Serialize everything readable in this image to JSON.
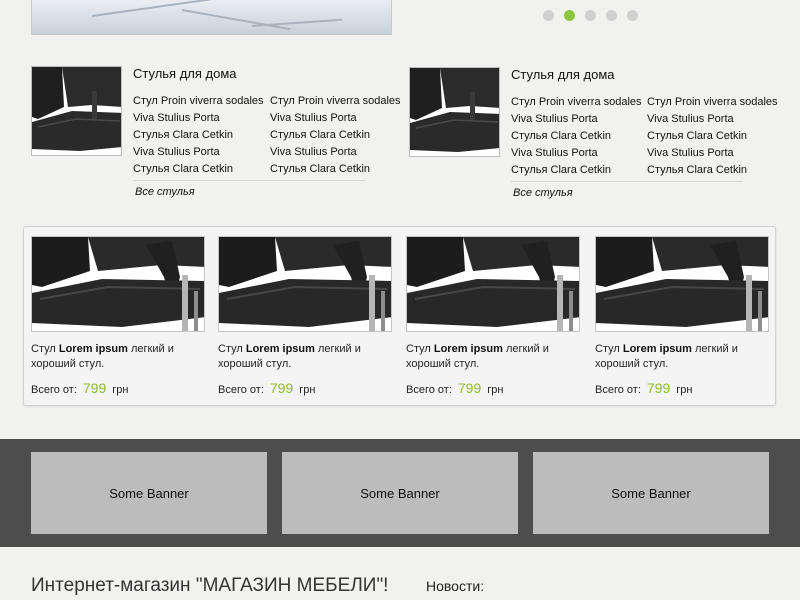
{
  "slider": {
    "dots_count": 5,
    "active_dot": 2
  },
  "categories": [
    {
      "title": "Стулья для дома",
      "col1": [
        "Стул Proin viverra sodales",
        "Viva Stulius Porta",
        "Стулья Clara Cetkin",
        "Viva Stulius Porta",
        "Стулья Clara Cetkin"
      ],
      "col2": [
        "Стул Proin viverra sodales",
        "Viva Stulius Porta",
        "Стулья Clara Cetkin",
        "Viva Stulius Porta",
        "Стулья Clara Cetkin"
      ],
      "all_link": "Все стулья"
    },
    {
      "title": "Стулья для дома",
      "col1": [
        "Стул Proin viverra sodales",
        "Viva Stulius Porta",
        "Стулья Clara Cetkin",
        "Viva Stulius Porta",
        "Стулья Clara Cetkin"
      ],
      "col2": [
        "Стул Proin viverra sodales",
        "Viva Stulius Porta",
        "Стулья Clara Cetkin",
        "Viva Stulius Porta",
        "Стулья Clara Cetkin"
      ],
      "all_link": "Все стулья"
    }
  ],
  "products": [
    {
      "prefix": "Стул",
      "name": "Lorem ipsum",
      "suffix": "легкий и хороший стул.",
      "price_label": "Всего от:",
      "price": "799",
      "currency": "грн"
    },
    {
      "prefix": "Стул",
      "name": "Lorem ipsum",
      "suffix": "легкий и хороший стул.",
      "price_label": "Всего от:",
      "price": "799",
      "currency": "грн"
    },
    {
      "prefix": "Стул",
      "name": "Lorem ipsum",
      "suffix": "легкий и хороший стул.",
      "price_label": "Всего от:",
      "price": "799",
      "currency": "грн"
    },
    {
      "prefix": "Стул",
      "name": "Lorem ipsum",
      "suffix": "легкий и хороший стул.",
      "price_label": "Всего от:",
      "price": "799",
      "currency": "грн"
    }
  ],
  "banners": [
    "Some Banner",
    "Some Banner",
    "Some Banner"
  ],
  "footer": {
    "shop_title": "Интернет-магазин \"МАГАЗИН МЕБЕЛИ\"!",
    "news_title": "Новости:"
  },
  "colors": {
    "accent": "#8cc63f",
    "price": "#8cbd2f",
    "band": "#4d4d4d",
    "banner": "#bcbcbc"
  },
  "icons": {
    "slider_dot": "circle",
    "chair_image": "black-office-chair"
  }
}
